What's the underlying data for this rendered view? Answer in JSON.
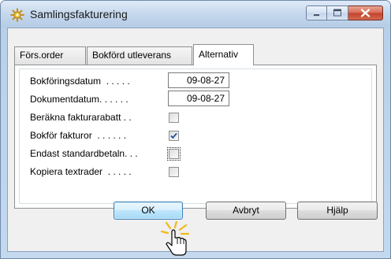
{
  "window": {
    "title": "Samlingsfakturering",
    "icon": "gear-sparkle-icon",
    "controls": {
      "minimize": "minimize-icon",
      "maximize": "maximize-icon",
      "close": "close-icon"
    },
    "colors": {
      "close_button": "#c4442c",
      "frame": "#b9d0e9"
    }
  },
  "tabs": [
    {
      "label": "Förs.order",
      "active": false
    },
    {
      "label": "Bokförd utleverans",
      "active": false
    },
    {
      "label": "Alternativ",
      "active": true
    }
  ],
  "fields": {
    "bokforingsdatum": {
      "label": "Bokföringsdatum  . . . . .",
      "value": "09-08-27"
    },
    "dokumentdatum": {
      "label": "Dokumentdatum. . . . . .",
      "value": "09-08-27"
    },
    "berakna_fakturarabatt": {
      "label": "Beräkna fakturarabatt . .",
      "checked": false
    },
    "bokfor_fakturor": {
      "label": "Bokför fakturor  . . . . . .",
      "checked": true
    },
    "endast_standardbetaln": {
      "label": "Endast standardbetaln. . .",
      "checked": false,
      "focused": true
    },
    "kopiera_textrader": {
      "label": "Kopiera textrader  . . . . .",
      "checked": false
    }
  },
  "buttons": {
    "ok": "OK",
    "cancel": "Avbryt",
    "help": "Hjälp"
  },
  "cursor": "hand-pointer-click-icon"
}
